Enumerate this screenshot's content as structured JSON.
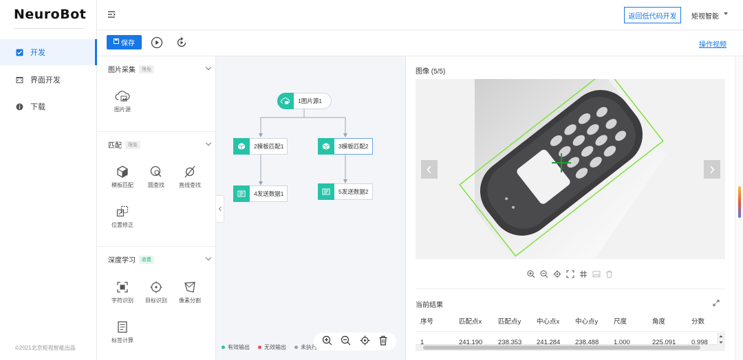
{
  "logo": "NeuroBot",
  "sidebar": {
    "items": [
      {
        "label": "开发",
        "icon": "checkbox-icon",
        "active": true
      },
      {
        "label": "界面开发",
        "icon": "code-window-icon",
        "active": false
      },
      {
        "label": "下载",
        "icon": "info-circle-icon",
        "active": false
      }
    ],
    "copyright": "©2021北京矩视智能出品"
  },
  "header": {
    "back_button": "返回低代码开发",
    "user_name": "矩视智能"
  },
  "toolbar": {
    "save_label": "保存",
    "video_link": "操作视频"
  },
  "tool_panel": {
    "sections": [
      {
        "title": "图片采集",
        "tag": "限免",
        "tools": [
          {
            "label": "图片源",
            "icon": "cloud-image-icon"
          }
        ]
      },
      {
        "title": "匹配",
        "tag": "限免",
        "tools": [
          {
            "label": "模板匹配",
            "icon": "cube-icon"
          },
          {
            "label": "圆查找",
            "icon": "circle-search-icon"
          },
          {
            "label": "直线查找",
            "icon": "line-search-icon"
          },
          {
            "label": "位置修正",
            "icon": "position-correct-icon"
          }
        ]
      },
      {
        "title": "深度学习",
        "tag": "收费",
        "tools": [
          {
            "label": "字符识别",
            "icon": "ocr-icon"
          },
          {
            "label": "目标识别",
            "icon": "target-icon"
          },
          {
            "label": "像素分割",
            "icon": "segment-icon"
          },
          {
            "label": "标签计算",
            "icon": "label-calc-icon"
          }
        ]
      }
    ]
  },
  "flow": {
    "nodes": [
      {
        "label": "1图片源1"
      },
      {
        "label": "2模板匹配1"
      },
      {
        "label": "3模板匹配2"
      },
      {
        "label": "4发送数据1"
      },
      {
        "label": "5发送数据2"
      }
    ],
    "legend": [
      {
        "label": "有效输出",
        "color": "#26c3a8"
      },
      {
        "label": "无效输出",
        "color": "#f04a4a"
      },
      {
        "label": "未执行",
        "color": "#9aa3ad"
      }
    ]
  },
  "image_panel": {
    "title": "图像 (5/5)"
  },
  "results": {
    "title": "当前结果",
    "columns": [
      "序号",
      "匹配点x",
      "匹配点y",
      "中心点x",
      "中心点y",
      "尺度",
      "角度",
      "分数"
    ],
    "rows": [
      [
        "1",
        "241.190",
        "238.353",
        "241.284",
        "238.488",
        "1.000",
        "225.091",
        "0.998"
      ]
    ]
  },
  "colors": {
    "accent": "#1677e6",
    "node": "#26c3a8",
    "match_box": "#7ee33a"
  }
}
